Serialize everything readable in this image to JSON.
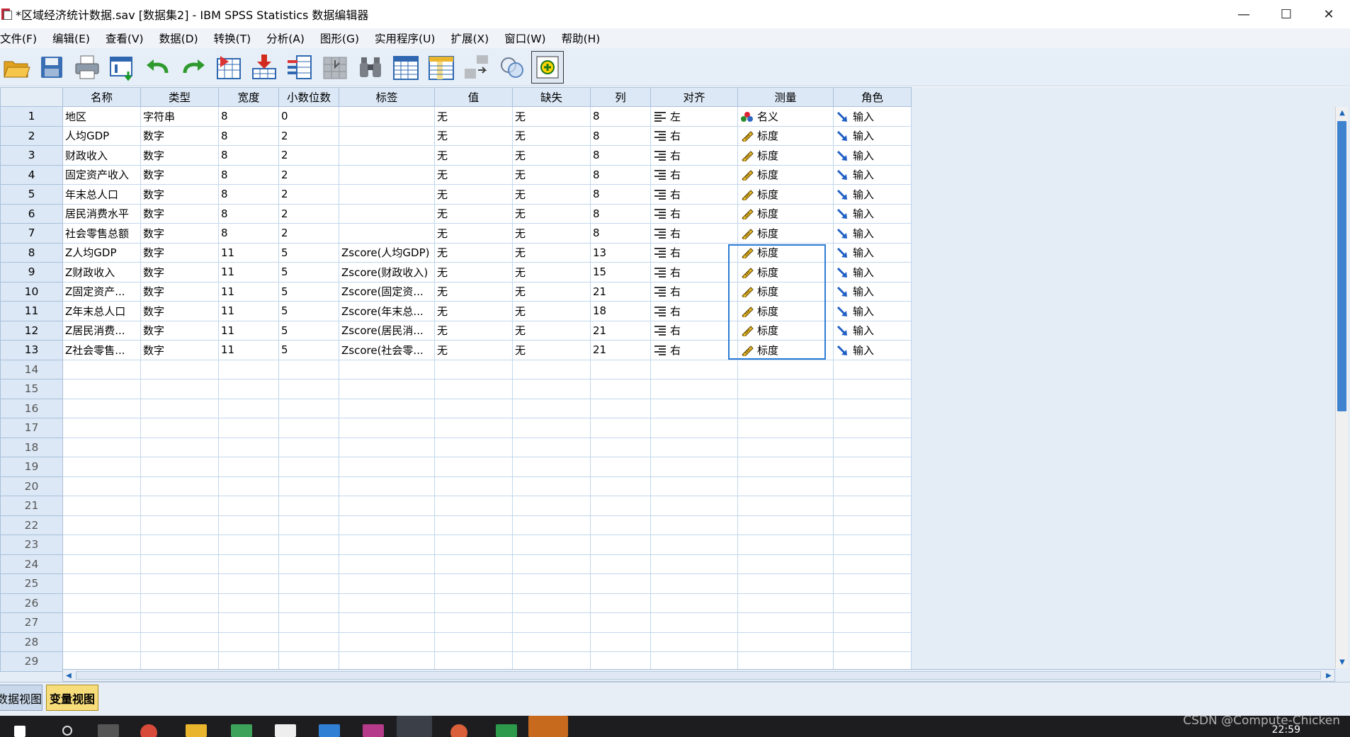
{
  "window": {
    "title": "*区域经济统计数据.sav [数据集2] - IBM SPSS Statistics 数据编辑器"
  },
  "window_controls": {
    "minimize": "—",
    "maximize": "☐",
    "close": "✕"
  },
  "menu": [
    "文件(F)",
    "编辑(E)",
    "查看(V)",
    "数据(D)",
    "转换(T)",
    "分析(A)",
    "图形(G)",
    "实用程序(U)",
    "扩展(X)",
    "窗口(W)",
    "帮助(H)"
  ],
  "toolbar_icons": [
    "open-folder-icon",
    "save-icon",
    "print-icon",
    "recall-dialog-icon",
    "undo-icon",
    "redo-icon",
    "goto-case-icon",
    "goto-variable-icon",
    "variables-icon",
    "run-descriptives-icon",
    "find-icon",
    "insert-cases-icon",
    "insert-variable-icon",
    "split-file-icon",
    "weight-cases-icon",
    "value-labels-icon"
  ],
  "columns": [
    "名称",
    "类型",
    "宽度",
    "小数位数",
    "标签",
    "值",
    "缺失",
    "列",
    "对齐",
    "测量",
    "角色"
  ],
  "rows": [
    {
      "num": "1",
      "name": "地区",
      "type": "字符串",
      "width": "8",
      "decimals": "0",
      "label": "",
      "values": "无",
      "missing": "无",
      "columns": "8",
      "align": "左",
      "align_icon": "align-left-icon",
      "measure": "名义",
      "measure_icon": "nominal-icon",
      "role": "输入"
    },
    {
      "num": "2",
      "name": "人均GDP",
      "type": "数字",
      "width": "8",
      "decimals": "2",
      "label": "",
      "values": "无",
      "missing": "无",
      "columns": "8",
      "align": "右",
      "align_icon": "align-right-icon",
      "measure": "标度",
      "measure_icon": "scale-ruler-icon",
      "role": "输入"
    },
    {
      "num": "3",
      "name": "财政收入",
      "type": "数字",
      "width": "8",
      "decimals": "2",
      "label": "",
      "values": "无",
      "missing": "无",
      "columns": "8",
      "align": "右",
      "align_icon": "align-right-icon",
      "measure": "标度",
      "measure_icon": "scale-ruler-icon",
      "role": "输入"
    },
    {
      "num": "4",
      "name": "固定资产收入",
      "type": "数字",
      "width": "8",
      "decimals": "2",
      "label": "",
      "values": "无",
      "missing": "无",
      "columns": "8",
      "align": "右",
      "align_icon": "align-right-icon",
      "measure": "标度",
      "measure_icon": "scale-ruler-icon",
      "role": "输入"
    },
    {
      "num": "5",
      "name": "年末总人口",
      "type": "数字",
      "width": "8",
      "decimals": "2",
      "label": "",
      "values": "无",
      "missing": "无",
      "columns": "8",
      "align": "右",
      "align_icon": "align-right-icon",
      "measure": "标度",
      "measure_icon": "scale-ruler-icon",
      "role": "输入"
    },
    {
      "num": "6",
      "name": "居民消费水平",
      "type": "数字",
      "width": "8",
      "decimals": "2",
      "label": "",
      "values": "无",
      "missing": "无",
      "columns": "8",
      "align": "右",
      "align_icon": "align-right-icon",
      "measure": "标度",
      "measure_icon": "scale-ruler-icon",
      "role": "输入"
    },
    {
      "num": "7",
      "name": "社会零售总额",
      "type": "数字",
      "width": "8",
      "decimals": "2",
      "label": "",
      "values": "无",
      "missing": "无",
      "columns": "8",
      "align": "右",
      "align_icon": "align-right-icon",
      "measure": "标度",
      "measure_icon": "scale-ruler-icon",
      "role": "输入"
    },
    {
      "num": "8",
      "name": "Z人均GDP",
      "type": "数字",
      "width": "11",
      "decimals": "5",
      "label": "Zscore(人均GDP)",
      "values": "无",
      "missing": "无",
      "columns": "13",
      "align": "右",
      "align_icon": "align-right-icon",
      "measure": "标度",
      "measure_icon": "scale-ruler-icon",
      "role": "输入"
    },
    {
      "num": "9",
      "name": "Z财政收入",
      "type": "数字",
      "width": "11",
      "decimals": "5",
      "label": "Zscore(财政收入)",
      "values": "无",
      "missing": "无",
      "columns": "15",
      "align": "右",
      "align_icon": "align-right-icon",
      "measure": "标度",
      "measure_icon": "scale-ruler-icon",
      "role": "输入"
    },
    {
      "num": "10",
      "name": "Z固定资产...",
      "type": "数字",
      "width": "11",
      "decimals": "5",
      "label": "Zscore(固定资...",
      "values": "无",
      "missing": "无",
      "columns": "21",
      "align": "右",
      "align_icon": "align-right-icon",
      "measure": "标度",
      "measure_icon": "scale-ruler-icon",
      "role": "输入"
    },
    {
      "num": "11",
      "name": "Z年末总人口",
      "type": "数字",
      "width": "11",
      "decimals": "5",
      "label": "Zscore(年末总...",
      "values": "无",
      "missing": "无",
      "columns": "18",
      "align": "右",
      "align_icon": "align-right-icon",
      "measure": "标度",
      "measure_icon": "scale-ruler-icon",
      "role": "输入"
    },
    {
      "num": "12",
      "name": "Z居民消费...",
      "type": "数字",
      "width": "11",
      "decimals": "5",
      "label": "Zscore(居民消...",
      "values": "无",
      "missing": "无",
      "columns": "21",
      "align": "右",
      "align_icon": "align-right-icon",
      "measure": "标度",
      "measure_icon": "scale-ruler-icon",
      "role": "输入"
    },
    {
      "num": "13",
      "name": "Z社会零售...",
      "type": "数字",
      "width": "11",
      "decimals": "5",
      "label": "Zscore(社会零...",
      "values": "无",
      "missing": "无",
      "columns": "21",
      "align": "右",
      "align_icon": "align-right-icon",
      "measure": "标度",
      "measure_icon": "scale-ruler-icon",
      "role": "输入"
    }
  ],
  "empty_rows": [
    "14",
    "15",
    "16",
    "17",
    "18",
    "19",
    "20",
    "21",
    "22",
    "23",
    "24",
    "25",
    "26",
    "27",
    "28",
    "29"
  ],
  "tabs": {
    "data_view": "数据视图",
    "variable_view": "变量视图",
    "active": "变量视图"
  },
  "taskbar": {
    "clock": "22:59"
  },
  "watermark": "CSDN @Compute-Chicken",
  "colors": {
    "selection_border": "#2c7bd4",
    "active_tab": "#f7dc7a",
    "header_bg": "#dce8f6",
    "scroll_thumb": "#3f82cf"
  }
}
